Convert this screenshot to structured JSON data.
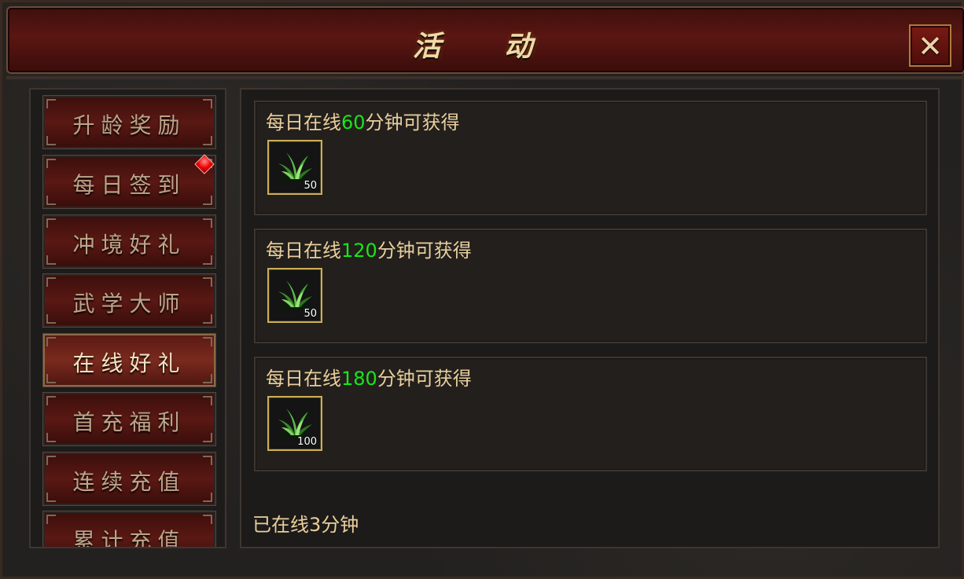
{
  "window": {
    "title": "活 动",
    "close_icon": "close-x-icon",
    "accent_color": "#5a1612"
  },
  "sidebar": {
    "items": [
      {
        "label": "升龄奖励",
        "active": false,
        "badge": false
      },
      {
        "label": "每日签到",
        "active": false,
        "badge": true
      },
      {
        "label": "冲境好礼",
        "active": false,
        "badge": false
      },
      {
        "label": "武学大师",
        "active": false,
        "badge": false
      },
      {
        "label": "在线好礼",
        "active": true,
        "badge": false
      },
      {
        "label": "首充福利",
        "active": false,
        "badge": false
      },
      {
        "label": "连续充值",
        "active": false,
        "badge": false
      },
      {
        "label": "累计充值",
        "active": false,
        "badge": false
      }
    ]
  },
  "rewards": [
    {
      "prefix": "每日在线",
      "minutes": "60",
      "suffix": "分钟可获得",
      "item_icon": "herb-grass-icon",
      "count": "50"
    },
    {
      "prefix": "每日在线",
      "minutes": "120",
      "suffix": "分钟可获得",
      "item_icon": "herb-grass-icon",
      "count": "50"
    },
    {
      "prefix": "每日在线",
      "minutes": "180",
      "suffix": "分钟可获得",
      "item_icon": "herb-grass-icon",
      "count": "100"
    }
  ],
  "status": {
    "online_text": "已在线3分钟"
  },
  "colors": {
    "highlight_number": "#19e619",
    "text_gold": "#e9cf9d",
    "slot_border": "#cbb055"
  }
}
